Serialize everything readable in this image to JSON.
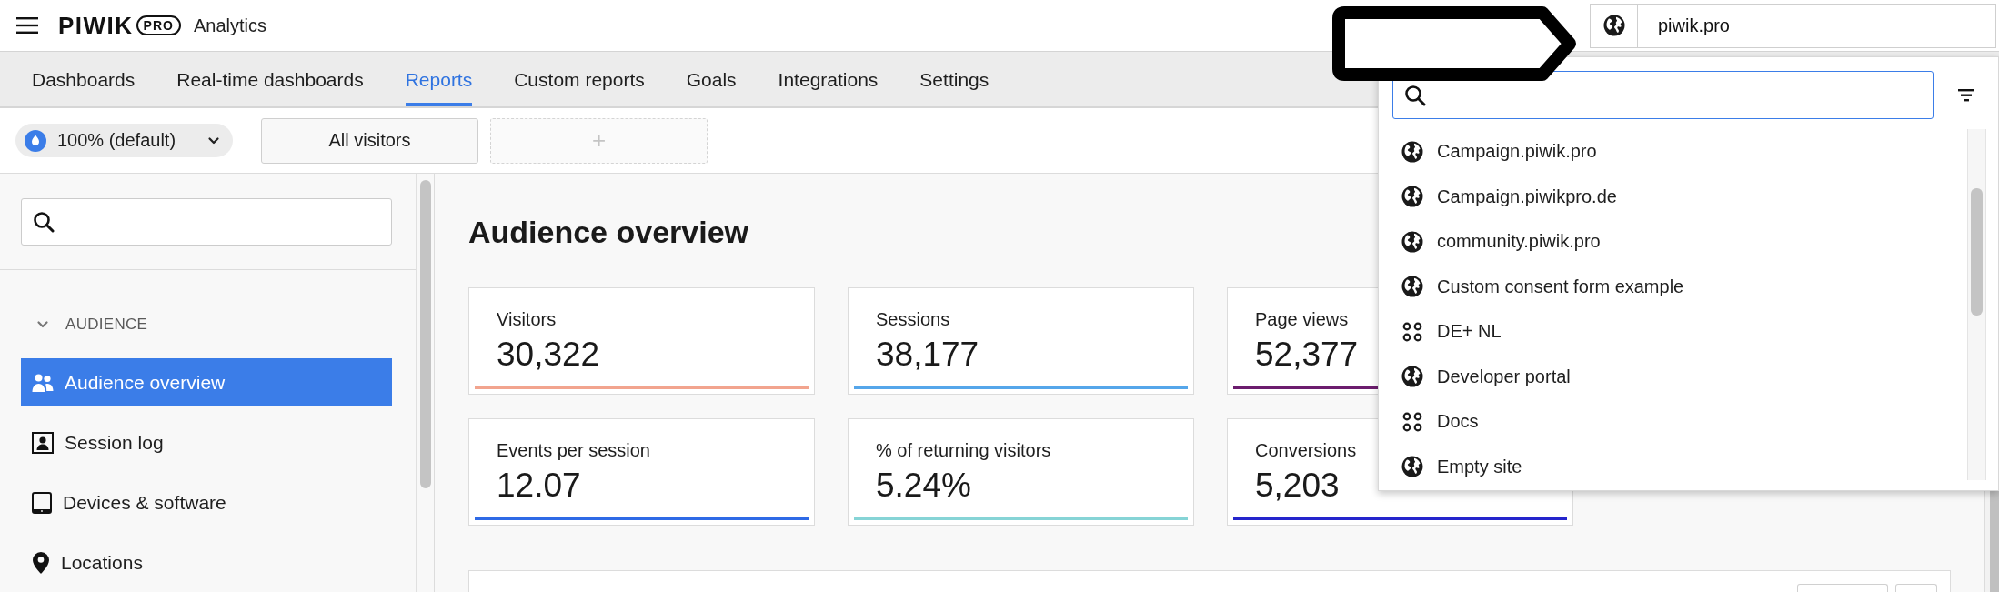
{
  "header": {
    "brand_name": "PIWIK",
    "brand_badge": "PRO",
    "product": "Analytics",
    "site_selector": {
      "value": "piwik.pro"
    }
  },
  "nav": {
    "tabs": [
      {
        "label": "Dashboards",
        "selected": false
      },
      {
        "label": "Real-time dashboards",
        "selected": false
      },
      {
        "label": "Reports",
        "selected": true
      },
      {
        "label": "Custom reports",
        "selected": false
      },
      {
        "label": "Goals",
        "selected": false
      },
      {
        "label": "Integrations",
        "selected": false
      },
      {
        "label": "Settings",
        "selected": false
      }
    ]
  },
  "toolbar": {
    "sampling": "100% (default)",
    "segments": [
      {
        "label": "All visitors",
        "kind": "segment"
      },
      {
        "label": "+",
        "kind": "add"
      }
    ]
  },
  "sidebar": {
    "sections": [
      {
        "title": "AUDIENCE",
        "expanded": true,
        "items": [
          {
            "label": "Audience overview",
            "selected": true
          },
          {
            "label": "Session log",
            "selected": false
          },
          {
            "label": "Devices & software",
            "selected": false
          },
          {
            "label": "Locations",
            "selected": false
          }
        ]
      }
    ]
  },
  "main": {
    "title": "Audience overview",
    "metrics": [
      {
        "label": "Visitors",
        "value": "30,322",
        "color": "#f2a48e"
      },
      {
        "label": "Sessions",
        "value": "38,177",
        "color": "#55a6ea"
      },
      {
        "label": "Page views",
        "value": "52,377",
        "color": "#6c1d6e"
      },
      {
        "label": "Events per session",
        "value": "12.07",
        "color": "#2e6ae6"
      },
      {
        "label": "% of returning visitors",
        "value": "5.24%",
        "color": "#86d4d6"
      },
      {
        "label": "Conversions",
        "value": "5,203",
        "color": "#2525cc"
      }
    ]
  },
  "site_dropdown": {
    "sites": [
      {
        "name": "Campaign.piwik.pro",
        "kind": "website"
      },
      {
        "name": "Campaign.piwikpro.de",
        "kind": "website"
      },
      {
        "name": "community.piwik.pro",
        "kind": "website"
      },
      {
        "name": "Custom consent form example",
        "kind": "website"
      },
      {
        "name": "DE+ NL",
        "kind": "app"
      },
      {
        "name": "Developer portal",
        "kind": "website"
      },
      {
        "name": "Docs",
        "kind": "app"
      },
      {
        "name": "Empty site",
        "kind": "website"
      }
    ]
  }
}
